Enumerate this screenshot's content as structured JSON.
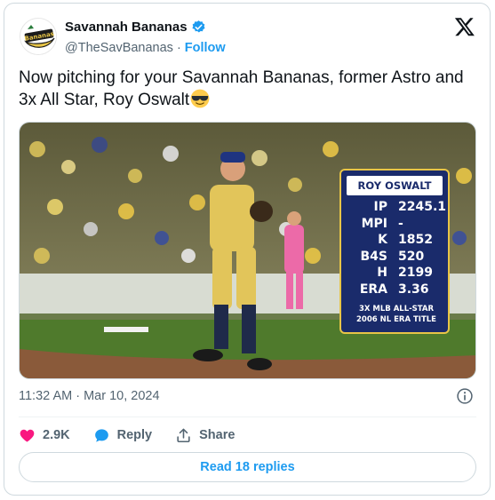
{
  "author": {
    "display_name": "Savannah Bananas",
    "handle": "@TheSavBananas",
    "separator": "·",
    "follow_label": "Follow",
    "avatar_text": "Bananas",
    "verified_icon": "verified-badge-icon",
    "brand_color": "#e8c547"
  },
  "tweet": {
    "text": "Now pitching for your Savannah Bananas, former Astro and 3x All Star, Roy Oswalt",
    "emoji_icon": "sunglasses-face-icon"
  },
  "media": {
    "stat_card": {
      "title": "ROY OSWALT",
      "rows": [
        {
          "label": "IP",
          "value": "2245.1"
        },
        {
          "label": "MPI",
          "value": "-"
        },
        {
          "label": "K",
          "value": "1852"
        },
        {
          "label": "B4S",
          "value": "520"
        },
        {
          "label": "H",
          "value": "2199"
        },
        {
          "label": "ERA",
          "value": "3.36"
        }
      ],
      "footer_line1": "3X MLB ALL-STAR",
      "footer_line2": "2006 NL ERA TITLE",
      "bg_color": "#1a2b6b",
      "border_color": "#e8c547"
    }
  },
  "meta": {
    "timestamp": "11:32 AM · Mar 10, 2024"
  },
  "actions": {
    "likes_count": "2.9K",
    "reply_label": "Reply",
    "share_label": "Share",
    "read_replies_label": "Read 18 replies",
    "like_color": "#f91880",
    "link_color": "#1d9bf0"
  }
}
